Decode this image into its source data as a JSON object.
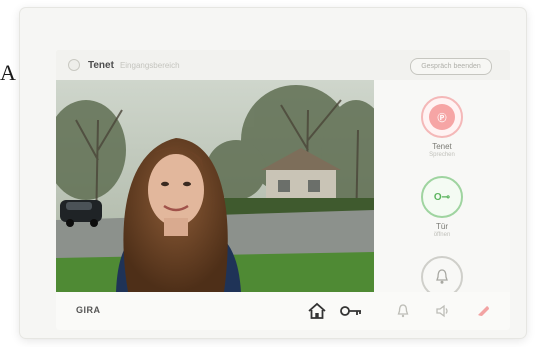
{
  "page": {
    "edge_letter": "A",
    "brand": "GIRA"
  },
  "topbar": {
    "caller_name": "Tenet",
    "caller_sub": "Eingangsbereich",
    "end_call_label": "Gespräch beenden"
  },
  "actions": [
    {
      "icon": "phone-icon",
      "glyph": "Ⓟ",
      "label": "Tenet",
      "sub": "Sprechen",
      "state": "red"
    },
    {
      "icon": "key-icon",
      "glyph": "O⊸",
      "label": "Tür",
      "sub": "öffnen",
      "state": "green"
    },
    {
      "icon": "bell-icon",
      "glyph": "",
      "label": "",
      "sub": "",
      "state": "grey"
    }
  ],
  "nav": [
    {
      "name": "home",
      "icon": "home-icon"
    },
    {
      "name": "door-open",
      "icon": "key-icon"
    },
    {
      "name": "light",
      "icon": "bell-icon"
    },
    {
      "name": "volume",
      "icon": "speaker-icon"
    },
    {
      "name": "hangup",
      "icon": "hangup-icon"
    }
  ],
  "colors": {
    "accent_red": "#e05a5a",
    "accent_green": "#5bb45e",
    "screen_bg": "#fbfbfa"
  }
}
